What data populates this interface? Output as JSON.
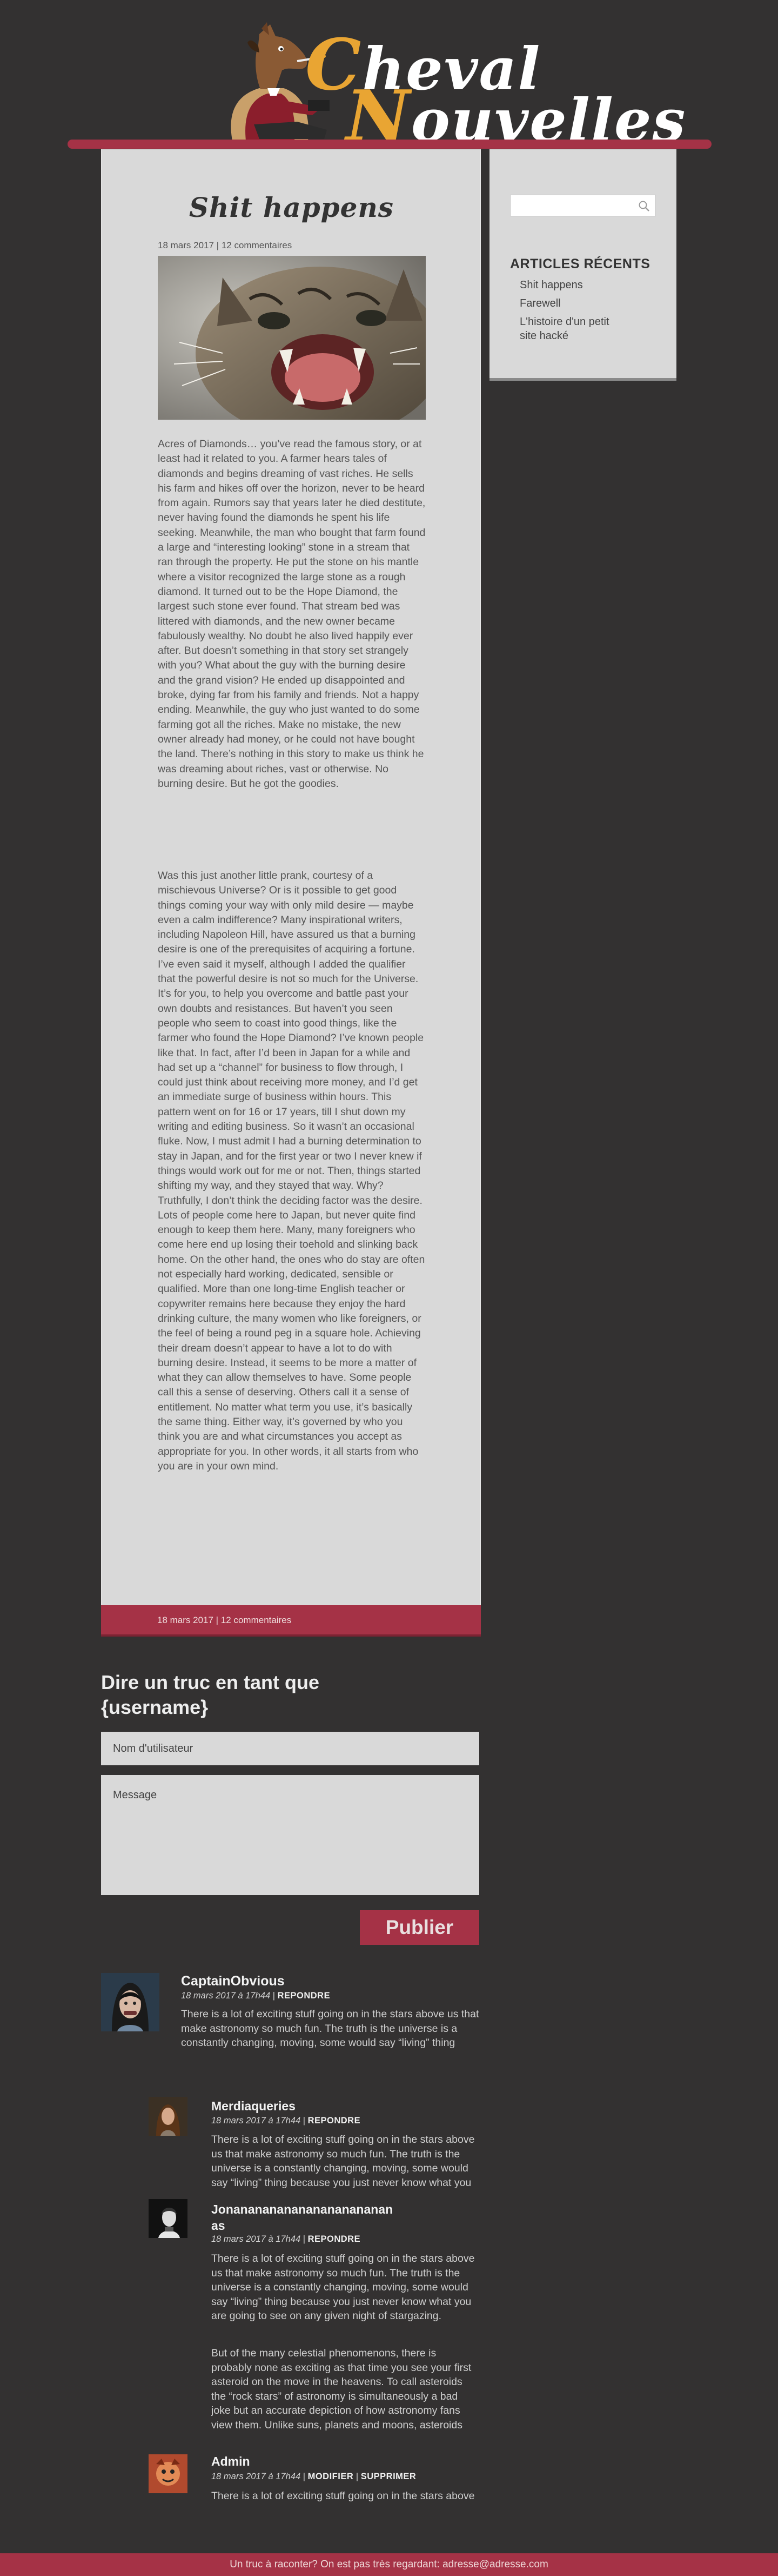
{
  "site": {
    "logo_line1_cap": "C",
    "logo_line1_rest": "heval",
    "logo_line2_cap": "N",
    "logo_line2_rest": "ouvelles"
  },
  "article": {
    "title": "Shit happens",
    "date": "18 mars 2017",
    "separator": " | ",
    "comments_link": "12 commentaires",
    "paragraphs": [
      "Acres of Diamonds… you’ve read the famous story, or at least had it related to you. A farmer hears tales of diamonds and begins dreaming of vast riches. He sells his farm and hikes off over the horizon, never to be heard from again. Rumors say that years later he died destitute, never having found the diamonds he spent his life seeking. Meanwhile, the man who bought that farm found a large and “interesting looking” stone in a stream that ran through the property. He put the stone on his mantle where a visitor recognized the large stone as a rough diamond. It turned out to be the Hope Diamond, the largest such stone ever found. That stream bed was littered with diamonds, and the new owner became fabulously wealthy. No doubt he also lived happily ever after. But doesn’t something in that story set strangely with you? What about the guy with the burning desire and the grand vision? He ended up disappointed and broke, dying far from his family and friends. Not a happy ending. Meanwhile, the guy who just wanted to do some farming got all the riches. Make no mistake, the new owner already had money, or he could not have bought the land. There’s nothing in this story to make us think he was dreaming about riches, vast or otherwise. No burning desire. But he got the goodies.",
      "Was this just another little prank, courtesy of a mischievous Universe? Or is it possible to get good things coming your way with only mild desire — maybe even a calm indifference? Many inspirational writers, including Napoleon Hill, have assured us that a burning desire is one of the prerequisites of acquiring a fortune. I’ve even said it myself, although I added the qualifier that the powerful desire is not so much for the Universe. It’s for you, to help you overcome and battle past your own doubts and resistances. But haven’t you seen people who seem to coast into good things, like the farmer who found the Hope Diamond? I’ve known people like that. In fact, after I’d been in Japan for a while and had set up a “channel” for business to flow through, I could just think about receiving more money, and I’d get an immediate surge of business within hours. This pattern went on for 16 or 17 years, till I shut down my writing and editing business. So it wasn’t an occasional fluke. Now, I must admit I had a burning determination to stay in Japan, and for the first year or two I never knew if things would work out for me or not. Then, things started shifting my way, and they stayed that way. Why? Truthfully, I don’t think the deciding factor was the desire. Lots of people come here to Japan, but never quite find enough to keep them here. Many, many foreigners who come here end up losing their toehold and slinking back home. On the other hand, the ones who do stay are often not especially hard working, dedicated, sensible or qualified. More than one long-time English teacher or copywriter remains here because they enjoy the hard drinking culture, the many women who like foreigners, or the feel of being a round peg in a square hole. Achieving their dream doesn’t appear to have a lot to do with burning desire. Instead, it seems to be more a matter of what they can allow themselves to have. Some people call this a sense of deserving. Others call it a sense of entitlement. No matter what term you use, it’s basically the same thing. Either way, it’s governed by who you think you are and what circumstances you accept as appropriate for you. In other words, it all starts from who you are in your own mind."
    ]
  },
  "sidebar": {
    "search_placeholder": "",
    "recent_title": "ARTICLES RÉCENTS",
    "recent_items": [
      "Shit happens",
      "Farewell",
      "L'histoire d'un petit site hacké"
    ]
  },
  "comment_form": {
    "title": "Dire un truc en tant que {username}",
    "username_placeholder": "Nom d'utilisateur",
    "message_placeholder": "Message",
    "publish_label": "Publier"
  },
  "comments": [
    {
      "author": "CaptainObvious",
      "date": "18 mars 2017 à 17h44",
      "sep": " | ",
      "actions": [
        "REPONDRE"
      ],
      "text": "There is a lot of exciting stuff going on in the stars above us that make astronomy so much fun. The truth is the universe is a constantly changing, moving, some would say “living” thing because you just never know what you are going to see on any given night of stargazing."
    },
    {
      "author": "Merdiaqueries",
      "date": "18 mars 2017 à 17h44",
      "sep": " | ",
      "actions": [
        "REPONDRE"
      ],
      "text": "There is a lot of exciting stuff going on in the stars above us that make astronomy so much fun. The truth is the universe is a constantly changing, moving, some would say “living” thing because you just never know what you are going to see on any given night of stargazing."
    },
    {
      "author": "Jonanananananananananananas",
      "date": "18 mars 2017 à 17h44",
      "sep": " | ",
      "actions": [
        "REPONDRE"
      ],
      "text": "There is a lot of exciting stuff going on in the stars above us that make astronomy so much fun. The truth is the universe is a constantly changing, moving, some would say “living” thing because you just never know what you are going to see on any given night of stargazing.",
      "text2": "But of the many celestial phenomenons, there is probably none as exciting as that time you see your first asteroid on the move in the heavens. To call asteroids the “rock stars” of astronomy is simultaneously a bad joke but an accurate depiction of how astronomy fans view them. Unlike suns, planets and moons, asteroids are on the move, ever changing and, if they appear in the night sky, exciting and dynamic."
    },
    {
      "author": "Admin",
      "date": "18 mars 2017 à 17h44",
      "sep": " | ",
      "actions": [
        "MODIFIER",
        "SUPPRIMER"
      ],
      "text": "There is a lot of exciting stuff going on in the stars above us that make astronomy so much fun."
    }
  ],
  "footer": {
    "text": "Un truc à raconter? On est pas très regardant: adresse@adresse.com"
  },
  "colors": {
    "accent": "#a53246",
    "logo_gold": "#e9a533",
    "background": "#333131",
    "panel": "#d9d9d9"
  },
  "icons": {
    "search": "search-icon",
    "horse": "horse-mascot-icon"
  }
}
